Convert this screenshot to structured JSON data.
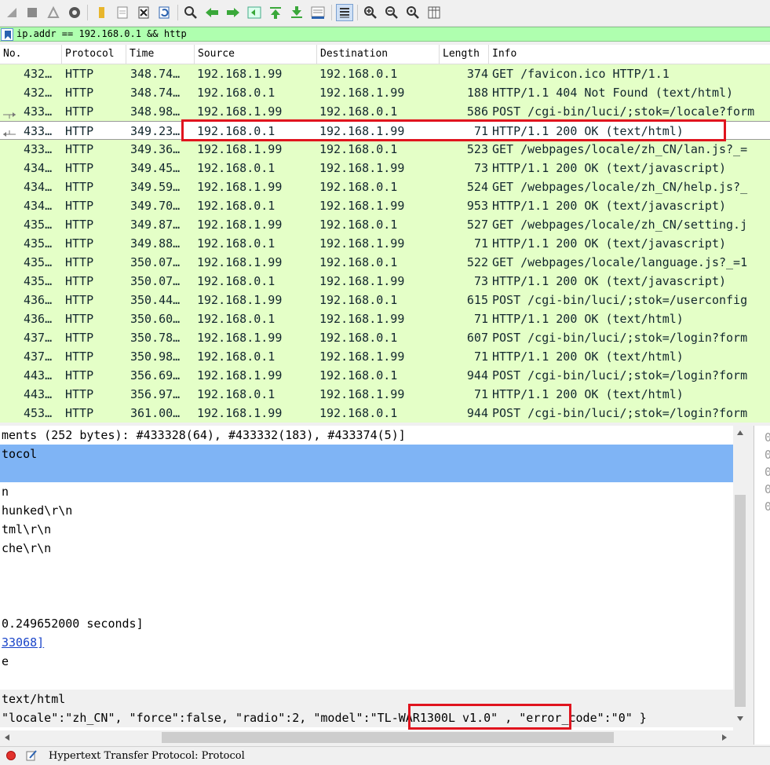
{
  "toolbar": {
    "buttons": [
      "stop-capture-icon",
      "restart-capture-icon",
      "capture-options-icon",
      "open-file-icon",
      "save-file-icon",
      "close-file-icon",
      "reload-file-icon",
      "find-packet-icon",
      "go-back-icon",
      "go-forward-icon",
      "go-to-packet-icon",
      "go-first-icon",
      "go-last-icon",
      "autoscroll-icon",
      "colorize-icon",
      "zoom-in-icon",
      "zoom-out-icon",
      "normal-size-icon",
      "resize-columns-icon"
    ]
  },
  "filter": {
    "value": "ip.addr == 192.168.0.1 && http"
  },
  "columns": [
    "No.",
    "Protocol",
    "Time",
    "Source",
    "Destination",
    "Length",
    "Info"
  ],
  "packets": [
    {
      "no": "432…",
      "proto": "HTTP",
      "time": "348.74…",
      "src": "192.168.1.99",
      "dst": "192.168.0.1",
      "len": "374",
      "info": "GET /favicon.ico HTTP/1.1"
    },
    {
      "no": "432…",
      "proto": "HTTP",
      "time": "348.74…",
      "src": "192.168.0.1",
      "dst": "192.168.1.99",
      "len": "188",
      "info": "HTTP/1.1 404 Not Found  (text/html)"
    },
    {
      "no": "433…",
      "proto": "HTTP",
      "time": "348.98…",
      "src": "192.168.1.99",
      "dst": "192.168.0.1",
      "len": "586",
      "info": "POST /cgi-bin/luci/;stok=/locale?form"
    },
    {
      "no": "433…",
      "proto": "HTTP",
      "time": "349.23…",
      "src": "192.168.0.1",
      "dst": "192.168.1.99",
      "len": "71",
      "info": "HTTP/1.1 200 OK  (text/html)"
    },
    {
      "no": "433…",
      "proto": "HTTP",
      "time": "349.36…",
      "src": "192.168.1.99",
      "dst": "192.168.0.1",
      "len": "523",
      "info": "GET /webpages/locale/zh_CN/lan.js?_="
    },
    {
      "no": "434…",
      "proto": "HTTP",
      "time": "349.45…",
      "src": "192.168.0.1",
      "dst": "192.168.1.99",
      "len": "73",
      "info": "HTTP/1.1 200 OK  (text/javascript)"
    },
    {
      "no": "434…",
      "proto": "HTTP",
      "time": "349.59…",
      "src": "192.168.1.99",
      "dst": "192.168.0.1",
      "len": "524",
      "info": "GET /webpages/locale/zh_CN/help.js?_"
    },
    {
      "no": "434…",
      "proto": "HTTP",
      "time": "349.70…",
      "src": "192.168.0.1",
      "dst": "192.168.1.99",
      "len": "953",
      "info": "HTTP/1.1 200 OK  (text/javascript)"
    },
    {
      "no": "435…",
      "proto": "HTTP",
      "time": "349.87…",
      "src": "192.168.1.99",
      "dst": "192.168.0.1",
      "len": "527",
      "info": "GET /webpages/locale/zh_CN/setting.j"
    },
    {
      "no": "435…",
      "proto": "HTTP",
      "time": "349.88…",
      "src": "192.168.0.1",
      "dst": "192.168.1.99",
      "len": "71",
      "info": "HTTP/1.1 200 OK  (text/javascript)"
    },
    {
      "no": "435…",
      "proto": "HTTP",
      "time": "350.07…",
      "src": "192.168.1.99",
      "dst": "192.168.0.1",
      "len": "522",
      "info": "GET /webpages/locale/language.js?_=1"
    },
    {
      "no": "435…",
      "proto": "HTTP",
      "time": "350.07…",
      "src": "192.168.0.1",
      "dst": "192.168.1.99",
      "len": "73",
      "info": "HTTP/1.1 200 OK  (text/javascript)"
    },
    {
      "no": "436…",
      "proto": "HTTP",
      "time": "350.44…",
      "src": "192.168.1.99",
      "dst": "192.168.0.1",
      "len": "615",
      "info": "POST /cgi-bin/luci/;stok=/userconfig"
    },
    {
      "no": "436…",
      "proto": "HTTP",
      "time": "350.60…",
      "src": "192.168.0.1",
      "dst": "192.168.1.99",
      "len": "71",
      "info": "HTTP/1.1 200 OK  (text/html)"
    },
    {
      "no": "437…",
      "proto": "HTTP",
      "time": "350.78…",
      "src": "192.168.1.99",
      "dst": "192.168.0.1",
      "len": "607",
      "info": "POST /cgi-bin/luci/;stok=/login?form"
    },
    {
      "no": "437…",
      "proto": "HTTP",
      "time": "350.98…",
      "src": "192.168.0.1",
      "dst": "192.168.1.99",
      "len": "71",
      "info": "HTTP/1.1 200 OK  (text/html)"
    },
    {
      "no": "443…",
      "proto": "HTTP",
      "time": "356.69…",
      "src": "192.168.1.99",
      "dst": "192.168.0.1",
      "len": "944",
      "info": "POST /cgi-bin/luci/;stok=/login?form"
    },
    {
      "no": "443…",
      "proto": "HTTP",
      "time": "356.97…",
      "src": "192.168.0.1",
      "dst": "192.168.1.99",
      "len": "71",
      "info": "HTTP/1.1 200 OK  (text/html)"
    },
    {
      "no": "453…",
      "proto": "HTTP",
      "time": "361.00…",
      "src": "192.168.1.99",
      "dst": "192.168.0.1",
      "len": "944",
      "info": "POST /cgi-bin/luci/;stok=/login?form"
    }
  ],
  "details": {
    "reassembled": "ments (252 bytes): #433328(64), #433332(183), #433374(5)]",
    "protocol": "tocol",
    "line_n": "n",
    "chunked": "hunked\\r\\n",
    "html": "tml\\r\\n",
    "cache": "che\\r\\n",
    "time_since": " 0.249652000 seconds]",
    "request_link": "33068]",
    "e_line": "e",
    "content_type": "text/html",
    "json_pre": " \"locale\":\"zh_CN\", \"force\":false, \"radio\":2, \"model\":",
    "json_model": "\"TL-WAR1300L v1.0\"",
    "json_post": " , \"error_code\":\"0\" }"
  },
  "bytes_pane": {
    "lines": [
      "0",
      "0",
      "0",
      "0",
      "0"
    ]
  },
  "status": {
    "text": "Hypertext Transfer Protocol: Protocol"
  },
  "colors": {
    "filter_ok": "#afffaf",
    "row_http": "#e4ffc7",
    "selected_detail": "#7fb4f5",
    "annotation": "#e0141e"
  }
}
